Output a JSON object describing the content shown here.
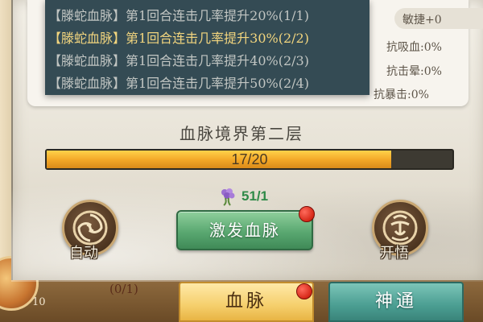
{
  "tooltip": {
    "lines": [
      {
        "text": "【滕蛇血脉】第1回合连击几率提升20%(1/1)",
        "active": false
      },
      {
        "text": "【滕蛇血脉】第1回合连击几率提升30%(2/2)",
        "active": true
      },
      {
        "text": "【滕蛇血脉】第1回合连击几率提升40%(2/3)",
        "active": false
      },
      {
        "text": "【滕蛇血脉】第1回合连击几率提升50%(2/4)",
        "active": false
      }
    ]
  },
  "stats": {
    "visible": [
      "敏捷+0",
      "抗吸血:0%",
      "抗击晕:0%",
      "抗暴击:0%"
    ]
  },
  "realm": {
    "title": "血脉境界第二层"
  },
  "progress": {
    "current": 17,
    "max": 20,
    "text": "17/20"
  },
  "cost": {
    "icon": "herb-icon",
    "text": "51/1"
  },
  "buttons": {
    "auto": {
      "label": "自动",
      "icon": "swirl-icon"
    },
    "activate": {
      "label": "激发血脉"
    },
    "enlighten": {
      "label": "开悟",
      "icon": "spirit-icon"
    }
  },
  "tabs": [
    {
      "label": "血脉",
      "selected": true,
      "badge": true
    },
    {
      "label": "神通",
      "selected": false,
      "badge": false
    }
  ],
  "background": {
    "counter": "(0/1)",
    "number": "10"
  },
  "colors": {
    "tooltip_bg": "#1e3842",
    "active_line": "#f2d57e",
    "inactive_line": "#c2c6c3",
    "progress_fill": "#f2a626",
    "activate_button": "#5aa871",
    "cost_text": "#2f8a48",
    "badge": "#d62818"
  }
}
